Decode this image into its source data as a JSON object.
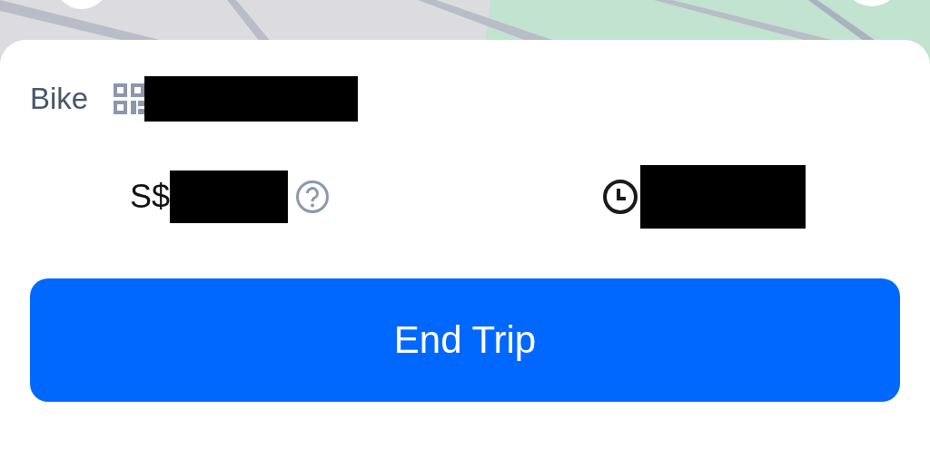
{
  "bike": {
    "label": "Bike"
  },
  "fare": {
    "currency": "S$"
  },
  "end_button": {
    "label": "End Trip"
  }
}
